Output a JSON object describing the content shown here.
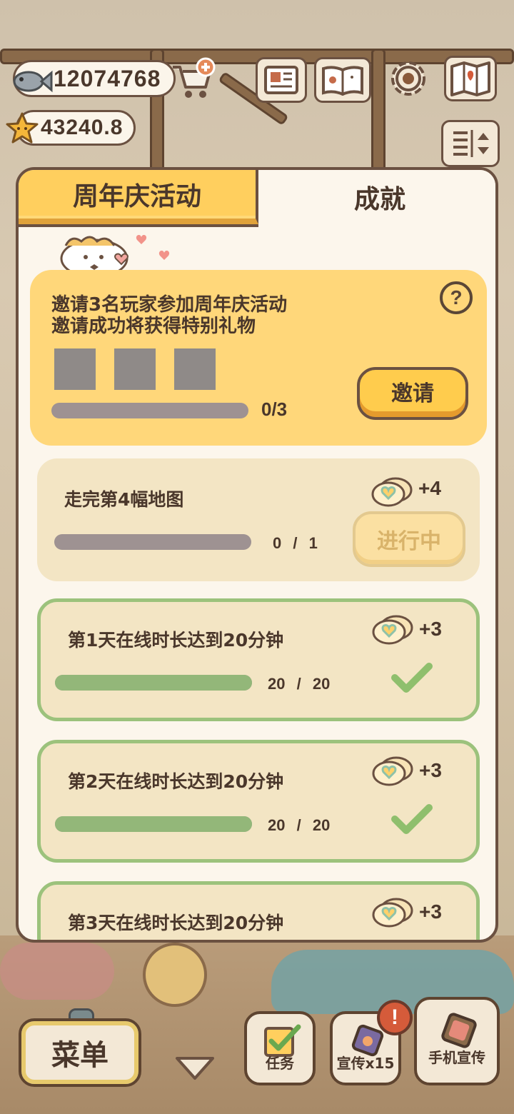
{
  "currency": {
    "fish_amount": "12074768",
    "star_amount": "43240.8",
    "fish_icon": "fish-icon",
    "star_icon": "star-icon",
    "cart_icon": "shop-cart-plus-icon"
  },
  "top_buttons": [
    "newspaper-icon",
    "paw-book-icon",
    "settings-gear-icon",
    "map-icon",
    "layout-toggle-icon"
  ],
  "tabs": {
    "active_label": "周年庆活动",
    "inactive_label": "成就"
  },
  "invite": {
    "line1": "邀请3名玩家参加周年庆活动",
    "line2": "邀请成功将获得特别礼物",
    "progress_text": "0/3",
    "progress": 0,
    "button_label": "邀请",
    "help_symbol": "?"
  },
  "tasks": [
    {
      "title": "走完第4幅地图",
      "reward": "+4",
      "current": "0",
      "sep": "/",
      "total": "1",
      "progress": 0,
      "status_label": "进行中"
    },
    {
      "title": "第1天在线时长达到20分钟",
      "reward": "+3",
      "current": "20",
      "sep": "/",
      "total": "20",
      "progress": 1
    },
    {
      "title": "第2天在线时长达到20分钟",
      "reward": "+3",
      "current": "20",
      "sep": "/",
      "total": "20",
      "progress": 1
    },
    {
      "title": "第3天在线时长达到20分钟",
      "reward": "+3"
    }
  ],
  "bottom": {
    "menu_label": "菜单",
    "task_label": "任务",
    "promo_label": "宣传x15",
    "phone_promo_label": "手机宣传",
    "alert_symbol": "!"
  },
  "colors": {
    "accent_yellow": "#ffcf5e",
    "done_green": "#9cc27c",
    "panel_bg": "#fcf6ec",
    "border_brown": "#6b5141"
  }
}
